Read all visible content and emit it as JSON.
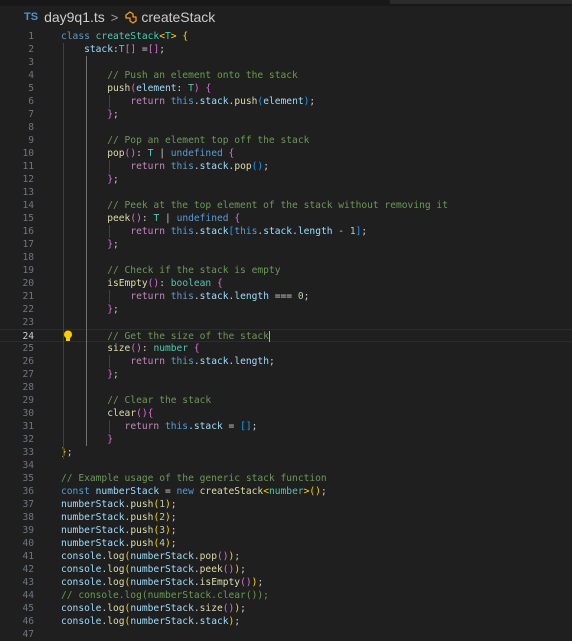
{
  "breadcrumb": {
    "lang_badge": "TS",
    "file": "day9q1.ts",
    "symbol": "createStack"
  },
  "editor": {
    "active_line": 24,
    "lines": [
      [
        [
          "k",
          "class "
        ],
        [
          "t",
          "createStack"
        ],
        [
          "b1",
          "<"
        ],
        [
          "t",
          "T"
        ],
        [
          "b1",
          "> {"
        ]
      ],
      [
        [
          "p",
          "    "
        ],
        [
          "v",
          "stack"
        ],
        [
          "p",
          ":"
        ],
        [
          "t",
          "T"
        ],
        [
          "b2",
          "[]"
        ],
        [
          "p",
          " ="
        ],
        [
          "b2",
          "[]"
        ],
        [
          "p",
          ";"
        ]
      ],
      [],
      [
        [
          "c",
          "        // Push an element onto the stack"
        ]
      ],
      [
        [
          "p",
          "        "
        ],
        [
          "f",
          "push"
        ],
        [
          "b2",
          "("
        ],
        [
          "v",
          "element"
        ],
        [
          "p",
          ": "
        ],
        [
          "t",
          "T"
        ],
        [
          "b2",
          ")"
        ],
        [
          "p",
          " "
        ],
        [
          "b2",
          "{"
        ]
      ],
      [
        [
          "p",
          "            "
        ],
        [
          "ctl",
          "return "
        ],
        [
          "k",
          "this"
        ],
        [
          "p",
          "."
        ],
        [
          "v",
          "stack"
        ],
        [
          "p",
          "."
        ],
        [
          "f",
          "push"
        ],
        [
          "b3",
          "("
        ],
        [
          "v",
          "element"
        ],
        [
          "b3",
          ")"
        ],
        [
          "p",
          ";"
        ]
      ],
      [
        [
          "p",
          "        "
        ],
        [
          "b2",
          "}"
        ],
        [
          "p",
          ";"
        ]
      ],
      [],
      [
        [
          "c",
          "        // Pop an element top off the stack"
        ]
      ],
      [
        [
          "p",
          "        "
        ],
        [
          "f",
          "pop"
        ],
        [
          "b2",
          "()"
        ],
        [
          "p",
          ": "
        ],
        [
          "t",
          "T"
        ],
        [
          "p",
          " | "
        ],
        [
          "k",
          "undefined"
        ],
        [
          "p",
          " "
        ],
        [
          "b2",
          "{"
        ]
      ],
      [
        [
          "p",
          "            "
        ],
        [
          "ctl",
          "return "
        ],
        [
          "k",
          "this"
        ],
        [
          "p",
          "."
        ],
        [
          "v",
          "stack"
        ],
        [
          "p",
          "."
        ],
        [
          "f",
          "pop"
        ],
        [
          "b3",
          "()"
        ],
        [
          "p",
          ";"
        ]
      ],
      [
        [
          "p",
          "        "
        ],
        [
          "b2",
          "}"
        ],
        [
          "p",
          ";"
        ]
      ],
      [],
      [
        [
          "c",
          "        // Peek at the top element of the stack without removing it"
        ]
      ],
      [
        [
          "p",
          "        "
        ],
        [
          "f",
          "peek"
        ],
        [
          "b2",
          "()"
        ],
        [
          "p",
          ": "
        ],
        [
          "t",
          "T"
        ],
        [
          "p",
          " | "
        ],
        [
          "k",
          "undefined"
        ],
        [
          "p",
          " "
        ],
        [
          "b2",
          "{"
        ]
      ],
      [
        [
          "p",
          "            "
        ],
        [
          "ctl",
          "return "
        ],
        [
          "k",
          "this"
        ],
        [
          "p",
          "."
        ],
        [
          "v",
          "stack"
        ],
        [
          "b3",
          "["
        ],
        [
          "k",
          "this"
        ],
        [
          "p",
          "."
        ],
        [
          "v",
          "stack"
        ],
        [
          "p",
          "."
        ],
        [
          "v",
          "length"
        ],
        [
          "p",
          " - "
        ],
        [
          "n",
          "1"
        ],
        [
          "b3",
          "]"
        ],
        [
          "p",
          ";"
        ]
      ],
      [
        [
          "p",
          "        "
        ],
        [
          "b2",
          "}"
        ],
        [
          "p",
          ";"
        ]
      ],
      [],
      [
        [
          "c",
          "        // Check if the stack is empty"
        ]
      ],
      [
        [
          "p",
          "        "
        ],
        [
          "f",
          "isEmpty"
        ],
        [
          "b2",
          "()"
        ],
        [
          "p",
          ": "
        ],
        [
          "t",
          "boolean"
        ],
        [
          "p",
          " "
        ],
        [
          "b2",
          "{"
        ]
      ],
      [
        [
          "p",
          "            "
        ],
        [
          "ctl",
          "return "
        ],
        [
          "k",
          "this"
        ],
        [
          "p",
          "."
        ],
        [
          "v",
          "stack"
        ],
        [
          "p",
          "."
        ],
        [
          "v",
          "length"
        ],
        [
          "p",
          " === "
        ],
        [
          "n",
          "0"
        ],
        [
          "p",
          ";"
        ]
      ],
      [
        [
          "p",
          "        "
        ],
        [
          "b2",
          "}"
        ],
        [
          "p",
          ";"
        ]
      ],
      [],
      [
        [
          "c",
          "        // Get the size of the stack"
        ],
        [
          "cur",
          ""
        ]
      ],
      [
        [
          "p",
          "        "
        ],
        [
          "f",
          "size"
        ],
        [
          "b2",
          "()"
        ],
        [
          "p",
          ": "
        ],
        [
          "t",
          "number"
        ],
        [
          "p",
          " "
        ],
        [
          "b2",
          "{"
        ]
      ],
      [
        [
          "p",
          "            "
        ],
        [
          "ctl",
          "return "
        ],
        [
          "k",
          "this"
        ],
        [
          "p",
          "."
        ],
        [
          "v",
          "stack"
        ],
        [
          "p",
          "."
        ],
        [
          "v",
          "length"
        ],
        [
          "p",
          ";"
        ]
      ],
      [
        [
          "p",
          "        "
        ],
        [
          "b2",
          "}"
        ],
        [
          "p",
          ";"
        ]
      ],
      [],
      [
        [
          "c",
          "        // Clear the stack"
        ]
      ],
      [
        [
          "p",
          "        "
        ],
        [
          "f",
          "clear"
        ],
        [
          "b2",
          "()"
        ],
        [
          "b2",
          "{"
        ]
      ],
      [
        [
          "p",
          "           "
        ],
        [
          "ctl",
          "return "
        ],
        [
          "k",
          "this"
        ],
        [
          "p",
          "."
        ],
        [
          "v",
          "stack"
        ],
        [
          "p",
          " = "
        ],
        [
          "b3",
          "[]"
        ],
        [
          "p",
          ";"
        ]
      ],
      [
        [
          "p",
          "        "
        ],
        [
          "b2",
          "}"
        ]
      ],
      [
        [
          "b1",
          "}"
        ],
        [
          "p",
          ";"
        ]
      ],
      [],
      [
        [
          "c",
          "// Example usage of the generic stack function"
        ]
      ],
      [
        [
          "k",
          "const "
        ],
        [
          "v",
          "numberStack"
        ],
        [
          "p",
          " = "
        ],
        [
          "k",
          "new "
        ],
        [
          "f",
          "createStack"
        ],
        [
          "b1",
          "<"
        ],
        [
          "t",
          "number"
        ],
        [
          "b1",
          ">"
        ],
        [
          "b1",
          "()"
        ],
        [
          "p",
          ";"
        ]
      ],
      [
        [
          "v",
          "numberStack"
        ],
        [
          "p",
          "."
        ],
        [
          "f",
          "push"
        ],
        [
          "b1",
          "("
        ],
        [
          "n",
          "1"
        ],
        [
          "b1",
          ")"
        ],
        [
          "p",
          ";"
        ]
      ],
      [
        [
          "v",
          "numberStack"
        ],
        [
          "p",
          "."
        ],
        [
          "f",
          "push"
        ],
        [
          "b1",
          "("
        ],
        [
          "n",
          "2"
        ],
        [
          "b1",
          ")"
        ],
        [
          "p",
          ";"
        ]
      ],
      [
        [
          "v",
          "numberStack"
        ],
        [
          "p",
          "."
        ],
        [
          "f",
          "push"
        ],
        [
          "b1",
          "("
        ],
        [
          "n",
          "3"
        ],
        [
          "b1",
          ")"
        ],
        [
          "p",
          ";"
        ]
      ],
      [
        [
          "v",
          "numberStack"
        ],
        [
          "p",
          "."
        ],
        [
          "f",
          "push"
        ],
        [
          "b1",
          "("
        ],
        [
          "n",
          "4"
        ],
        [
          "b1",
          ")"
        ],
        [
          "p",
          ";"
        ]
      ],
      [
        [
          "v",
          "console"
        ],
        [
          "p",
          "."
        ],
        [
          "f",
          "log"
        ],
        [
          "b1",
          "("
        ],
        [
          "v",
          "numberStack"
        ],
        [
          "p",
          "."
        ],
        [
          "f",
          "pop"
        ],
        [
          "b2",
          "()"
        ],
        [
          "b1",
          ")"
        ],
        [
          "p",
          ";"
        ]
      ],
      [
        [
          "v",
          "console"
        ],
        [
          "p",
          "."
        ],
        [
          "f",
          "log"
        ],
        [
          "b1",
          "("
        ],
        [
          "v",
          "numberStack"
        ],
        [
          "p",
          "."
        ],
        [
          "f",
          "peek"
        ],
        [
          "b2",
          "()"
        ],
        [
          "b1",
          ")"
        ],
        [
          "p",
          ";"
        ]
      ],
      [
        [
          "v",
          "console"
        ],
        [
          "p",
          "."
        ],
        [
          "f",
          "log"
        ],
        [
          "b1",
          "("
        ],
        [
          "v",
          "numberStack"
        ],
        [
          "p",
          "."
        ],
        [
          "f",
          "isEmpty"
        ],
        [
          "b2",
          "()"
        ],
        [
          "b1",
          ")"
        ],
        [
          "p",
          ";"
        ]
      ],
      [
        [
          "c",
          "// console.log(numberStack.clear());"
        ]
      ],
      [
        [
          "v",
          "console"
        ],
        [
          "p",
          "."
        ],
        [
          "f",
          "log"
        ],
        [
          "b1",
          "("
        ],
        [
          "v",
          "numberStack"
        ],
        [
          "p",
          "."
        ],
        [
          "f",
          "size"
        ],
        [
          "b2",
          "()"
        ],
        [
          "b1",
          ")"
        ],
        [
          "p",
          ";"
        ]
      ],
      [
        [
          "v",
          "console"
        ],
        [
          "p",
          "."
        ],
        [
          "f",
          "log"
        ],
        [
          "b1",
          "("
        ],
        [
          "v",
          "numberStack"
        ],
        [
          "p",
          "."
        ],
        [
          "v",
          "stack"
        ],
        [
          "b1",
          ")"
        ],
        [
          "p",
          ";"
        ]
      ],
      []
    ]
  }
}
